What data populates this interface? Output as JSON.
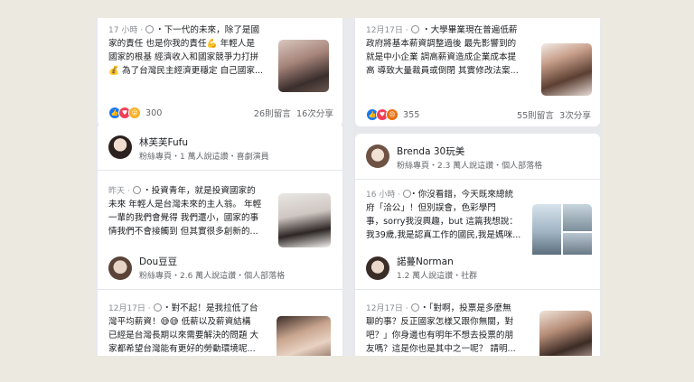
{
  "posts": {
    "top_left": {
      "time": "17 小時",
      "text": "・下一代的未來，除了是國\n家的責任 也是你我的責任💪 年輕人是\n國家的根基 經濟收入和國家競爭力打拼\n💰 為了台灣民主經濟更穩定 自己國家...",
      "reactions": "300",
      "comments": "26則留言",
      "shares": "16次分享"
    },
    "top_right": {
      "time": "12月17日",
      "text": "・大學畢業現在普遍低薪\n政府將基本薪資調整過後 最先影響到的\n就是中小企業 調高薪資造成企業成本提\n高 導致大量裁員或倒閉 其實修改法案...",
      "reactions": "355",
      "comments": "55則留言",
      "shares": "3次分享"
    },
    "mid_left": {
      "name": "林芙芙Fufu",
      "sub": "粉絲專頁・1 萬人說這讚・喜劇演員",
      "time": "昨天",
      "text": "・投資青年，就是投資國家的\n未來 年輕人是台灣未來的主人翁。 年輕\n一輩的我們會覺得 我們還小，國家的事\n情我們不會接觸到 但其實很多創新的..."
    },
    "mid_right": {
      "name": "Brenda  30玩美",
      "sub": "粉絲專頁・2.3 萬人說這讚・個人部落格",
      "time": "16 小時",
      "text": "・你沒看錯，今天既來總統\n府「洽公」！但別誤會，色彩學門\n事，sorry我沒興趣，but 這篇我想說：\n我39歲,我是認真工作的國民,我是媽咪..."
    },
    "bottom_left": {
      "name": "Dou豆豆",
      "sub": "粉絲專頁・2.6 萬人說這讚・個人部落格",
      "time": "12月17日",
      "text": "・對不起！是我拉低了台\n灣平均薪資！😅😅 低薪以及薪資結構\n已經是台灣長期以來需要解決的問題 大\n家都希望台灣能有更好的勞動環境呢..."
    },
    "bottom_right": {
      "name": "諾蔓Norman",
      "sub": "1.2 萬人說這讚・社群",
      "time": "12月17日",
      "text": "・「對啊，投票是多麼無\n聊的事？反正國家怎樣又跟你無關，對\n吧？」你身邊也有明年不想去投票的朋\n友嗎？這是你也是其中之一呢？ 請明..."
    }
  },
  "colors": {
    "like": "#1877f2",
    "heart": "#f33e58",
    "wow": "#f7b125",
    "angry": "#e9710f"
  },
  "icons": [
    "globe-icon",
    "like-reaction-icon",
    "heart-reaction-icon",
    "wow-reaction-icon",
    "angry-reaction-icon"
  ]
}
